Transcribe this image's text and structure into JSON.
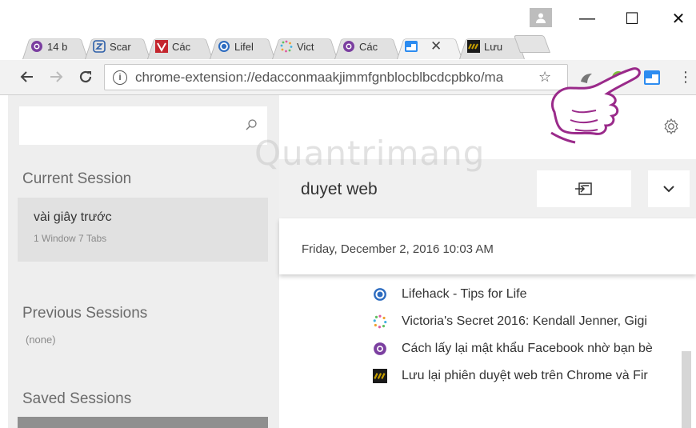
{
  "browser": {
    "tabs": [
      {
        "label": "14 b",
        "icon": "quora-icon",
        "color": "#7b3fa0"
      },
      {
        "label": "Scar",
        "icon": "zing-icon",
        "color": "#2d5fa8"
      },
      {
        "label": "Các",
        "icon": "vnexpress-icon",
        "color": "#c4262e"
      },
      {
        "label": "Lifel",
        "icon": "lifehack-icon",
        "color": "#2d6cc0"
      },
      {
        "label": "Vict",
        "icon": "victorias-secret-icon",
        "color": "#e05aa0"
      },
      {
        "label": "Các",
        "icon": "quora-icon",
        "color": "#7b3fa0"
      },
      {
        "label": "",
        "icon": "session-buddy-icon",
        "color": "#2d8cf0",
        "active": true
      },
      {
        "label": "Lưu",
        "icon": "quantrimang-icon",
        "color": "#c8a000"
      }
    ],
    "active_tab_close": "✕",
    "window_buttons": {
      "minimize": "—",
      "maximize": "☐",
      "close": "✕"
    },
    "url": "chrome-extension://edacconmaakjimmfgnblocblbcdcpbko/ma"
  },
  "sidebar": {
    "search_placeholder": "",
    "current_heading": "Current Session",
    "current_session": {
      "time": "vài giây trước",
      "meta": "1 Window  7 Tabs"
    },
    "previous_heading": "Previous Sessions",
    "previous_none": "(none)",
    "saved_heading": "Saved Sessions"
  },
  "main": {
    "session_name": "duyet web",
    "date": "Friday, December 2, 2016 10:03 AM",
    "tabs": [
      {
        "title": "Lifehack - Tips for Life",
        "icon": "lifehack-icon",
        "color": "#2d6cc0"
      },
      {
        "title": "Victoria's Secret 2016: Kendall Jenner, Gigi",
        "icon": "victorias-secret-icon",
        "color": "#e05aa0"
      },
      {
        "title": "Cách lấy lại mật khẩu Facebook nhờ bạn bè",
        "icon": "quora-icon",
        "color": "#7b3fa0"
      },
      {
        "title": "Lưu lại phiên duyệt web trên Chrome và Fir",
        "icon": "quantrimang-icon",
        "color": "#c8a000"
      }
    ]
  },
  "watermark": "Quantrimang"
}
